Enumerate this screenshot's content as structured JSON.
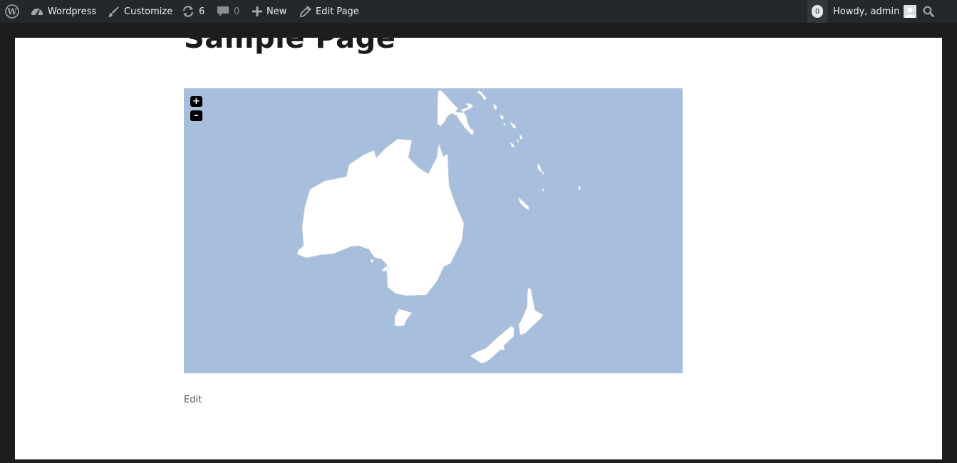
{
  "adminbar": {
    "site_name": "Wordpress",
    "customize": "Customize",
    "updates_count": "6",
    "comments_count": "0",
    "new_label": "New",
    "edit_label": "Edit Page",
    "notifications_count": "0",
    "greeting": "Howdy, admin"
  },
  "page": {
    "title": "Sample Page",
    "edit_link": "Edit"
  },
  "map": {
    "zoom_in": "+",
    "zoom_out": "–",
    "ocean_color": "#a7bfdc",
    "land_color": "#ffffff"
  }
}
